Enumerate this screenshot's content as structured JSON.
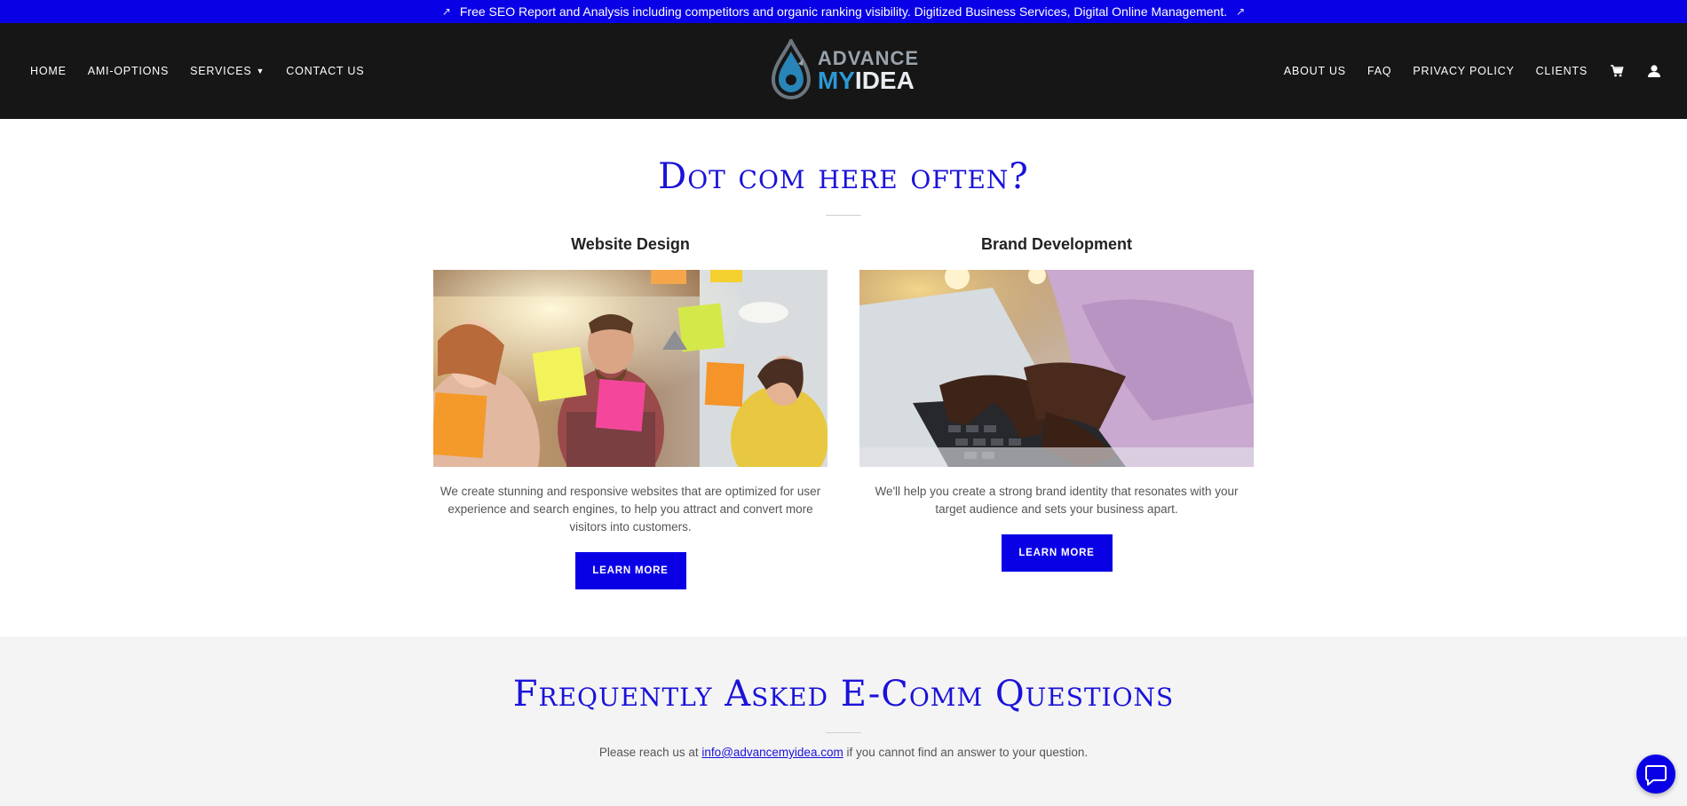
{
  "announcement": {
    "text": "Free SEO Report and Analysis including competitors and organic ranking visibility. Digitized Business Services, Digital Online Management."
  },
  "nav": {
    "left": [
      {
        "label": "HOME"
      },
      {
        "label": "AMI-OPTIONS"
      },
      {
        "label": "SERVICES"
      },
      {
        "label": "CONTACT US"
      }
    ],
    "right": [
      {
        "label": "ABOUT US"
      },
      {
        "label": "FAQ"
      },
      {
        "label": "PRIVACY POLICY"
      },
      {
        "label": "CLIENTS"
      }
    ],
    "icons": [
      "cart-icon",
      "account-icon"
    ]
  },
  "logo": {
    "top": "ADVANCE",
    "my": "MY",
    "idea": "IDEA"
  },
  "services_section": {
    "title": "Dot com here often?",
    "cards": [
      {
        "title": "Website Design",
        "text": "We create stunning and responsive websites that are optimized for user experience and search engines, to help you attract and convert more visitors into customers.",
        "button": "LEARN MORE"
      },
      {
        "title": "Brand Development",
        "text": "We'll help you create a strong brand identity that resonates with your target audience and sets your business apart.",
        "button": "LEARN MORE"
      }
    ]
  },
  "faq_section": {
    "title": "Frequently Asked E-Comm Questions",
    "text_before": "Please reach us at ",
    "email": "info@advancemyidea.com",
    "text_after": " if you cannot find an answer to your question."
  },
  "colors": {
    "brand_blue": "#0a00e6",
    "header_bg": "#161616",
    "faq_bg": "#f4f4f4"
  }
}
